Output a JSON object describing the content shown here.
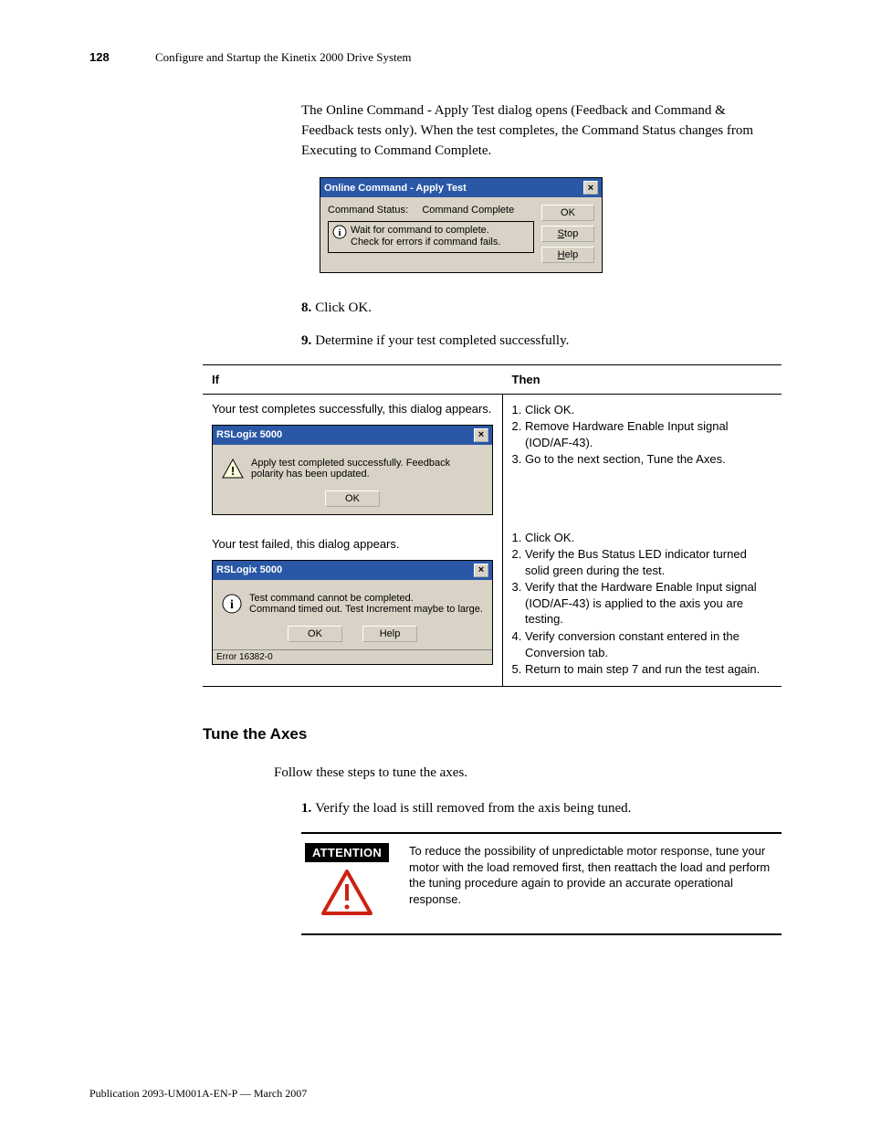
{
  "header": {
    "page": "128",
    "section": "Configure and Startup the Kinetix 2000 Drive System"
  },
  "intro": "The Online Command - Apply Test dialog opens (Feedback and Command & Feedback tests only). When the test completes, the Command Status changes from Executing to Command Complete.",
  "dialog": {
    "title": "Online Command - Apply Test",
    "statusLabel": "Command Status:",
    "statusValue": "Command Complete",
    "info1": "Wait for command to complete.",
    "info2": "Check for errors if command fails.",
    "ok": "OK",
    "stop": "Stop",
    "help": "Help"
  },
  "steps": {
    "s8n": "8.",
    "s8": "Click OK.",
    "s9n": "9.",
    "s9": "Determine if your test completed successfully."
  },
  "table": {
    "if": "If",
    "then": "Then",
    "r1if": "Your test completes successfully, this dialog appears.",
    "r1d": {
      "title": "RSLogix 5000",
      "msg": "Apply test completed successfully. Feedback polarity has been updated.",
      "ok": "OK"
    },
    "r1then": [
      "Click OK.",
      "Remove Hardware Enable Input signal (IOD/AF-43).",
      "Go to the next section, Tune the Axes."
    ],
    "r2if": "Your test failed, this dialog appears.",
    "r2d": {
      "title": "RSLogix 5000",
      "msg1": "Test command cannot be completed.",
      "msg2": "Command timed out. Test Increment maybe to large.",
      "ok": "OK",
      "help": "Help",
      "err": "Error 16382-0"
    },
    "r2then": [
      "Click OK.",
      "Verify the Bus Status LED indicator turned solid green during the test.",
      "Verify that the Hardware Enable Input signal (IOD/AF-43) is applied to the axis you are testing.",
      "Verify conversion constant entered in the Conversion tab.",
      "Return to main step 7 and run the test again."
    ]
  },
  "tune": {
    "heading": "Tune the Axes",
    "lead": "Follow these steps to tune the axes.",
    "s1n": "1.",
    "s1": "Verify the load is still removed from the axis being tuned.",
    "attnLabel": "ATTENTION",
    "attnText": "To reduce the possibility of unpredictable motor response, tune your motor with the load removed first, then reattach the load and perform the tuning procedure again to provide an accurate operational response."
  },
  "footer": "Publication 2093-UM001A-EN-P — March 2007"
}
